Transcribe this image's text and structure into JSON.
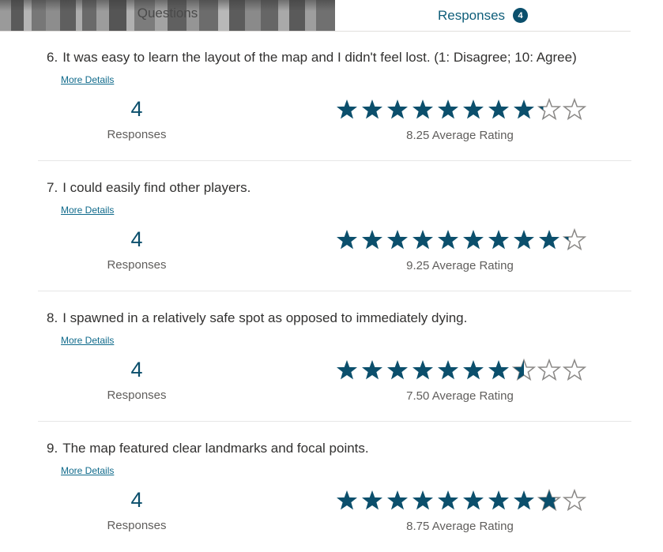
{
  "tabs": {
    "questions": "Questions",
    "responses": "Responses",
    "responses_badge": "4"
  },
  "colors": {
    "accent": "#0b4f6c",
    "star_filled": "#0b4f6c",
    "star_empty": "#8a8886"
  },
  "questions": [
    {
      "number": "6.",
      "text": "It was easy to learn the layout of the map and I didn't feel lost. (1: Disagree; 10: Agree)",
      "details_link": "More Details",
      "responses_count": "4",
      "responses_label": "Responses",
      "average_rating": 8.25,
      "average_label": "8.25 Average Rating",
      "max_rating": 10
    },
    {
      "number": "7.",
      "text": "I could easily find other players.",
      "details_link": "More Details",
      "responses_count": "4",
      "responses_label": "Responses",
      "average_rating": 9.25,
      "average_label": "9.25 Average Rating",
      "max_rating": 10
    },
    {
      "number": "8.",
      "text": "I spawned in a relatively safe spot as opposed to immediately dying.",
      "details_link": "More Details",
      "responses_count": "4",
      "responses_label": "Responses",
      "average_rating": 7.5,
      "average_label": "7.50 Average Rating",
      "max_rating": 10
    },
    {
      "number": "9.",
      "text": "The map featured clear landmarks and focal points.",
      "details_link": "More Details",
      "responses_count": "4",
      "responses_label": "Responses",
      "average_rating": 8.75,
      "average_label": "8.75 Average Rating",
      "max_rating": 10
    }
  ]
}
